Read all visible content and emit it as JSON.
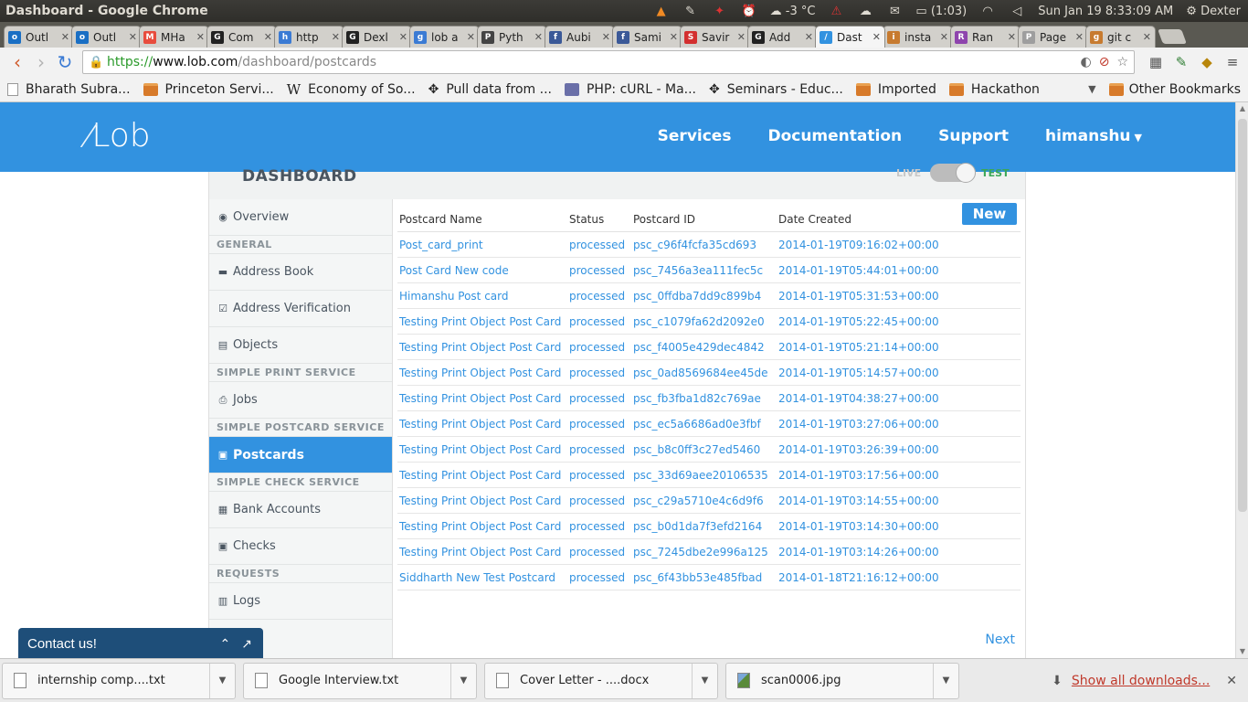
{
  "os": {
    "window_title": "Dashboard - Google Chrome",
    "weather": "-3 °C",
    "battery": "(1:03)",
    "datetime": "Sun Jan 19   8:33:09 AM",
    "user": "Dexter"
  },
  "tabs": [
    {
      "title": "Outl",
      "color": "#1a6fc4",
      "letter": "o"
    },
    {
      "title": "Outl",
      "color": "#1a6fc4",
      "letter": "o"
    },
    {
      "title": "MHa",
      "color": "#e84c3d",
      "letter": "M"
    },
    {
      "title": "Com",
      "color": "#222222",
      "letter": "G"
    },
    {
      "title": "http",
      "color": "#3b7bd4",
      "letter": "h"
    },
    {
      "title": "Dexl",
      "color": "#222222",
      "letter": "G"
    },
    {
      "title": "lob a",
      "color": "#3b7bd4",
      "letter": "g"
    },
    {
      "title": "Pyth",
      "color": "#444444",
      "letter": "P"
    },
    {
      "title": "Aubi",
      "color": "#3b5998",
      "letter": "f"
    },
    {
      "title": "Sami",
      "color": "#3b5998",
      "letter": "f"
    },
    {
      "title": "Savir",
      "color": "#d32f2f",
      "letter": "S"
    },
    {
      "title": "Add",
      "color": "#222222",
      "letter": "G"
    },
    {
      "title": "Dast",
      "color": "#3292e0",
      "letter": "/",
      "active": true
    },
    {
      "title": "insta",
      "color": "#c77b30",
      "letter": "i"
    },
    {
      "title": "Ran",
      "color": "#8e44ad",
      "letter": "R"
    },
    {
      "title": "Page",
      "color": "#9e9e9e",
      "letter": "P"
    },
    {
      "title": "git c",
      "color": "#c77b30",
      "letter": "g"
    }
  ],
  "address": {
    "scheme": "https://",
    "host": "www.lob.com",
    "path": "/dashboard/postcards"
  },
  "bookmarks": [
    {
      "label": "Bharath Subra...",
      "icon": "doc"
    },
    {
      "label": "Princeton Servi...",
      "icon": "folder"
    },
    {
      "label": "Economy of So...",
      "icon": "wiki"
    },
    {
      "label": "Pull data from ...",
      "icon": "gear"
    },
    {
      "label": "PHP: cURL - Ma...",
      "icon": "php"
    },
    {
      "label": "Seminars - Educ...",
      "icon": "gear"
    },
    {
      "label": "Imported",
      "icon": "folder"
    },
    {
      "label": "Hackathon",
      "icon": "folder"
    }
  ],
  "other_bookmarks": "Other Bookmarks",
  "lob": {
    "logo": "Lob",
    "nav": [
      "Services",
      "Documentation",
      "Support",
      "himanshu"
    ],
    "dashboard_title": "DASHBOARD",
    "toggle_live": "LIVE",
    "toggle_test": "TEST",
    "sidebar": [
      {
        "type": "item",
        "label": "Overview",
        "icon": "dashboard-icon",
        "glyph": "◉"
      },
      {
        "type": "section",
        "label": "GENERAL"
      },
      {
        "type": "item",
        "label": "Address Book",
        "icon": "book-icon",
        "glyph": "▬"
      },
      {
        "type": "item",
        "label": "Address Verification",
        "icon": "check-square-icon",
        "glyph": "☑"
      },
      {
        "type": "item",
        "label": "Objects",
        "icon": "file-icon",
        "glyph": "▤"
      },
      {
        "type": "section",
        "label": "SIMPLE PRINT SERVICE"
      },
      {
        "type": "item",
        "label": "Jobs",
        "icon": "print-icon",
        "glyph": "⎙"
      },
      {
        "type": "section",
        "label": "SIMPLE POSTCARD SERVICE"
      },
      {
        "type": "item",
        "label": "Postcards",
        "icon": "picture-icon",
        "glyph": "▣",
        "active": true
      },
      {
        "type": "section",
        "label": "SIMPLE CHECK SERVICE"
      },
      {
        "type": "item",
        "label": "Bank Accounts",
        "icon": "building-icon",
        "glyph": "▦"
      },
      {
        "type": "item",
        "label": "Checks",
        "icon": "money-icon",
        "glyph": "▣"
      },
      {
        "type": "section",
        "label": "REQUESTS"
      },
      {
        "type": "item",
        "label": "Logs",
        "icon": "archive-icon",
        "glyph": "▥"
      }
    ],
    "table": {
      "headers": [
        "Postcard Name",
        "Status",
        "Postcard ID",
        "Date Created"
      ],
      "new_button": "New",
      "rows": [
        [
          "Post_card_print",
          "processed",
          "psc_c96f4fcfa35cd693",
          "2014-01-19T09:16:02+00:00"
        ],
        [
          "Post Card New code",
          "processed",
          "psc_7456a3ea111fec5c",
          "2014-01-19T05:44:01+00:00"
        ],
        [
          "Himanshu Post card",
          "processed",
          "psc_0ffdba7dd9c899b4",
          "2014-01-19T05:31:53+00:00"
        ],
        [
          "Testing Print Object Post Card",
          "processed",
          "psc_c1079fa62d2092e0",
          "2014-01-19T05:22:45+00:00"
        ],
        [
          "Testing Print Object Post Card",
          "processed",
          "psc_f4005e429dec4842",
          "2014-01-19T05:21:14+00:00"
        ],
        [
          "Testing Print Object Post Card",
          "processed",
          "psc_0ad8569684ee45de",
          "2014-01-19T05:14:57+00:00"
        ],
        [
          "Testing Print Object Post Card",
          "processed",
          "psc_fb3fba1d82c769ae",
          "2014-01-19T04:38:27+00:00"
        ],
        [
          "Testing Print Object Post Card",
          "processed",
          "psc_ec5a6686ad0e3fbf",
          "2014-01-19T03:27:06+00:00"
        ],
        [
          "Testing Print Object Post Card",
          "processed",
          "psc_b8c0ff3c27ed5460",
          "2014-01-19T03:26:39+00:00"
        ],
        [
          "Testing Print Object Post Card",
          "processed",
          "psc_33d69aee20106535",
          "2014-01-19T03:17:56+00:00"
        ],
        [
          "Testing Print Object Post Card",
          "processed",
          "psc_c29a5710e4c6d9f6",
          "2014-01-19T03:14:55+00:00"
        ],
        [
          "Testing Print Object Post Card",
          "processed",
          "psc_b0d1da7f3efd2164",
          "2014-01-19T03:14:30+00:00"
        ],
        [
          "Testing Print Object Post Card",
          "processed",
          "psc_7245dbe2e996a125",
          "2014-01-19T03:14:26+00:00"
        ],
        [
          "Siddharth New Test Postcard",
          "processed",
          "psc_6f43bb53e485fbad",
          "2014-01-18T21:16:12+00:00"
        ]
      ],
      "next": "Next"
    },
    "contact": "Contact us!"
  },
  "downloads": [
    {
      "name": "internship comp....txt",
      "type": "doc"
    },
    {
      "name": "Google Interview.txt",
      "type": "doc"
    },
    {
      "name": "Cover Letter - ....docx",
      "type": "doc"
    },
    {
      "name": "scan0006.jpg",
      "type": "img"
    }
  ],
  "show_all_downloads": "Show all downloads...",
  "colors": {
    "lob_blue": "#3292e0",
    "contact_bg": "#1e4e79",
    "test_green": "#3aa757"
  }
}
